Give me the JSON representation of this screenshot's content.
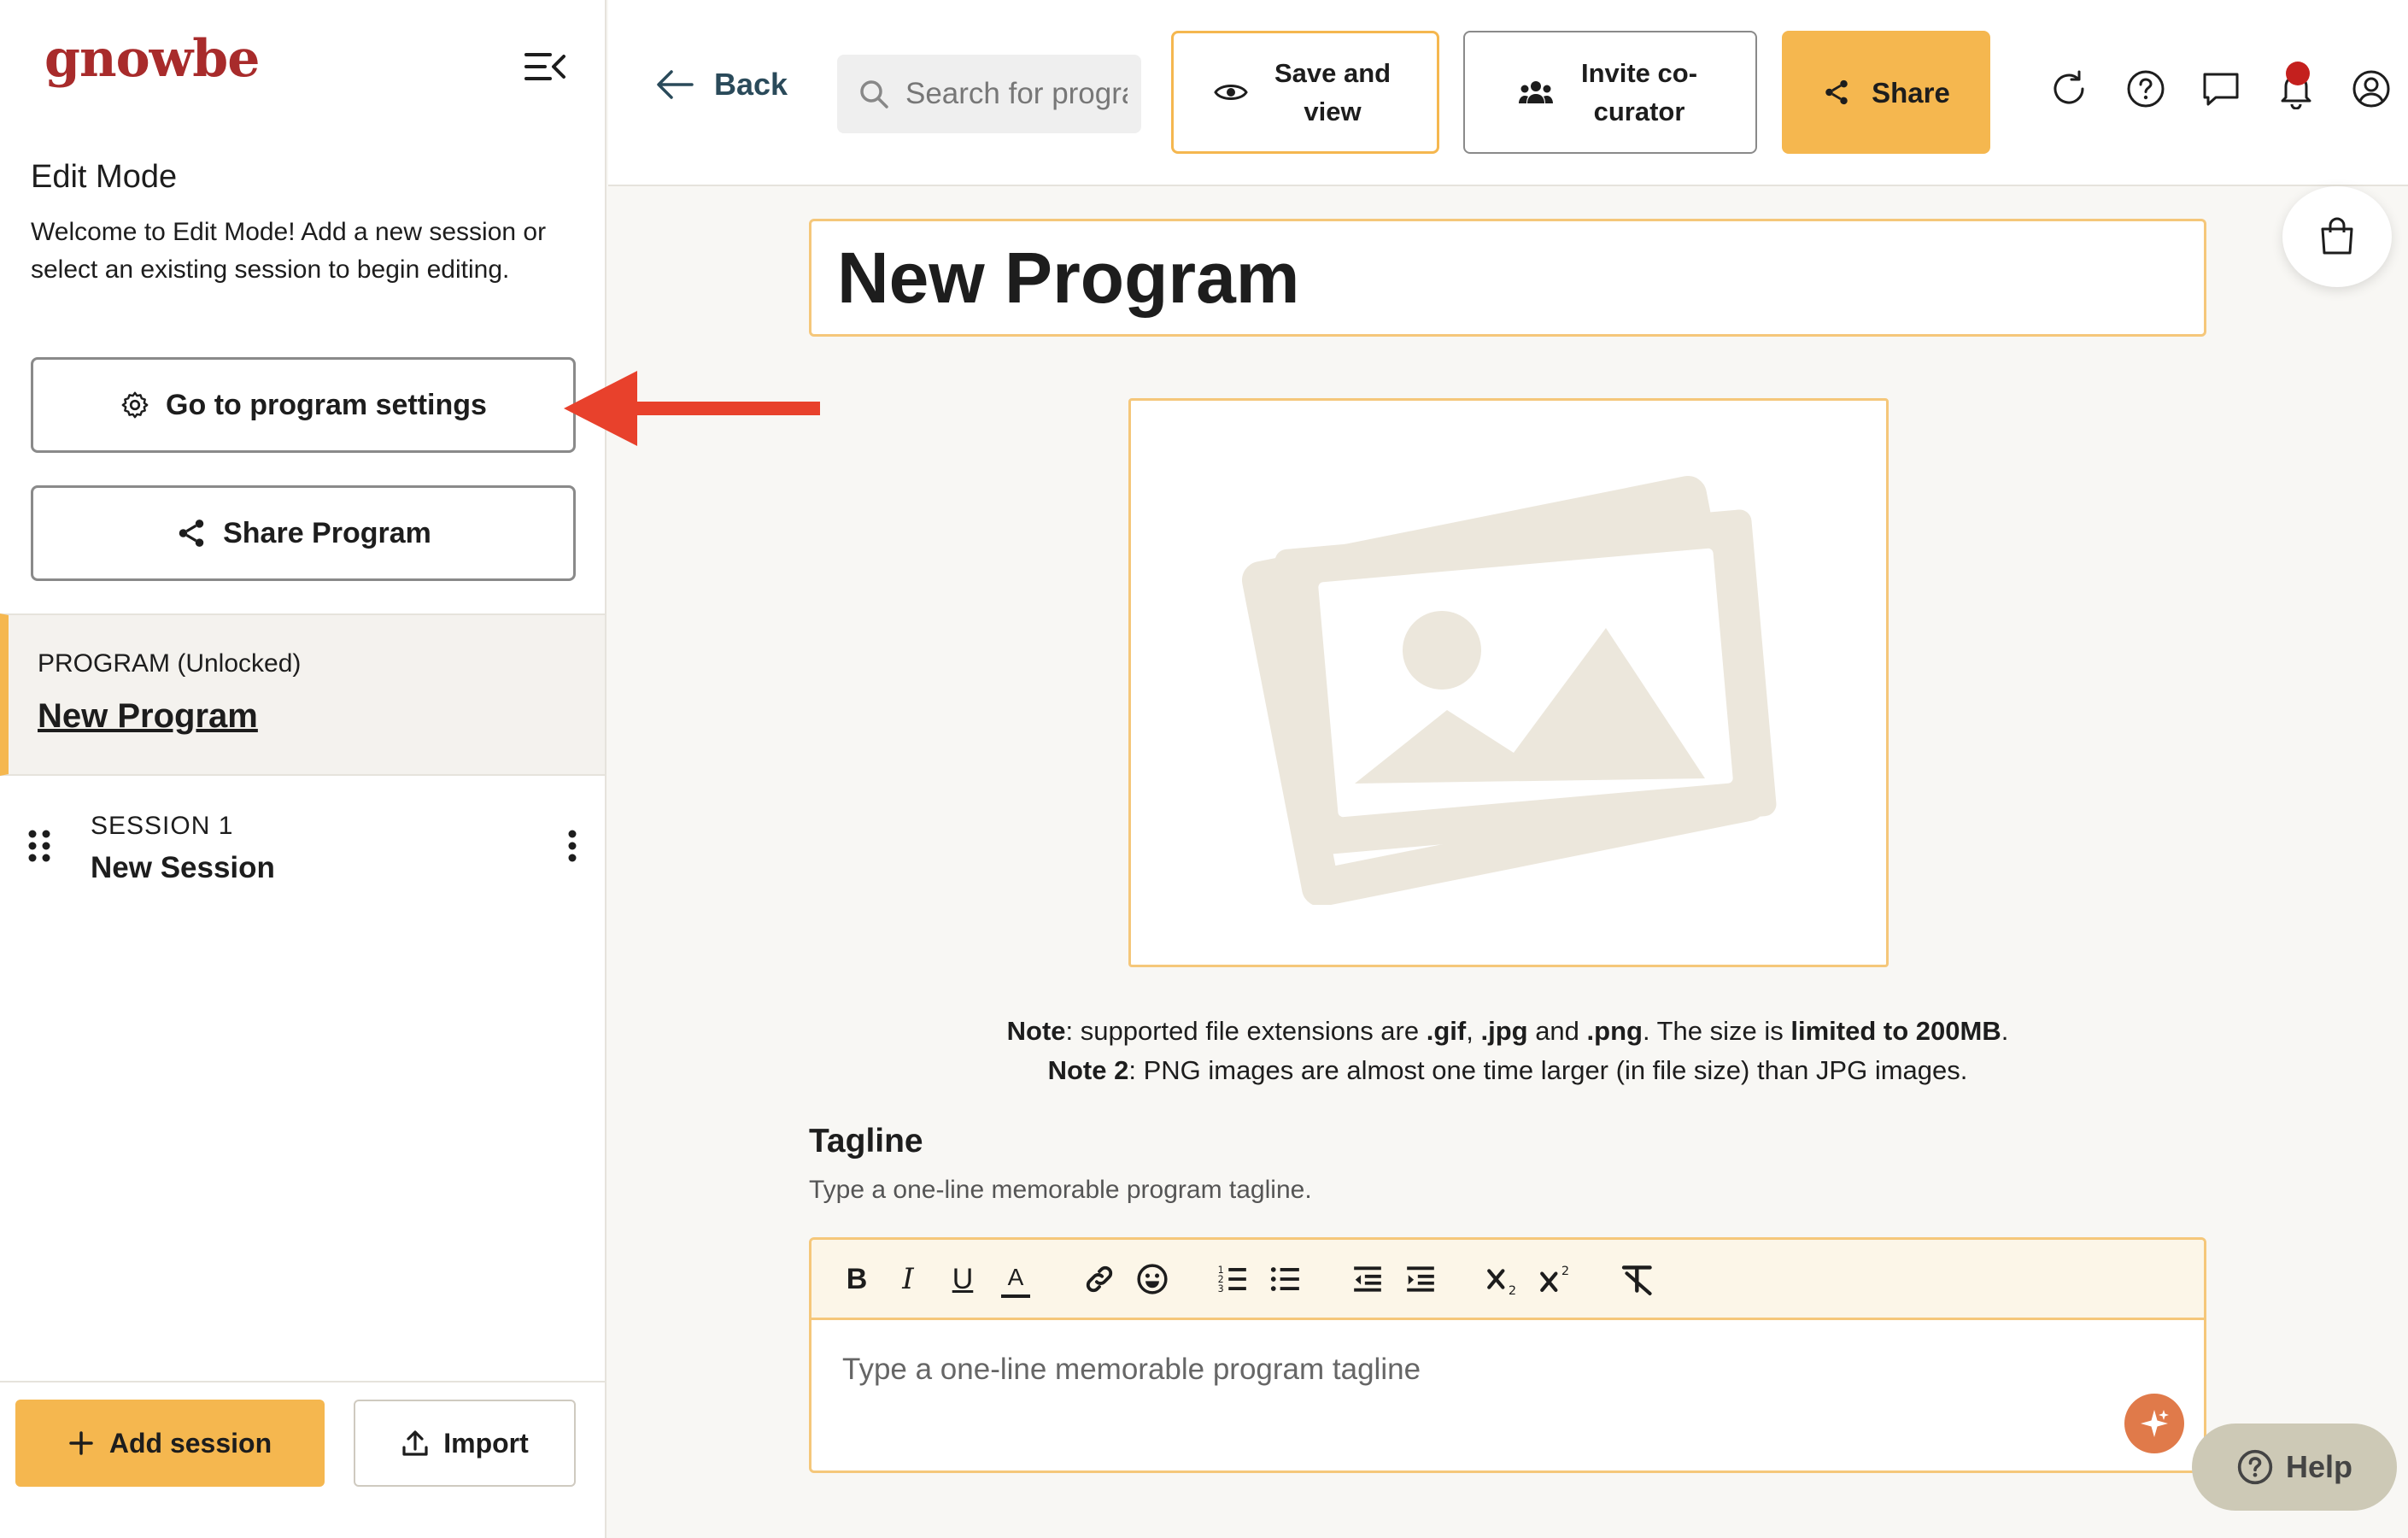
{
  "sidebar": {
    "logo": "gnowbe",
    "edit_title": "Edit Mode",
    "edit_desc": "Welcome to Edit Mode! Add a new session or select an existing session to begin editing.",
    "settings_label": "Go to program settings",
    "share_program_label": "Share Program",
    "program_label": "PROGRAM (Unlocked)",
    "program_name": "New Program",
    "session_label": "SESSION 1",
    "session_name": "New Session",
    "add_session_label": "Add session",
    "import_label": "Import"
  },
  "header": {
    "back_label": "Back",
    "search_placeholder": "Search for programs",
    "save_view_label": "Save and view",
    "invite_label": "Invite co-curator",
    "share_label": "Share"
  },
  "main": {
    "program_title": "New Program",
    "note1_label": "Note",
    "note1_text_a": ": supported file extensions are ",
    "note1_gif": ".gif",
    "note1_sep1": ", ",
    "note1_jpg": ".jpg",
    "note1_and": " and ",
    "note1_png": ".png",
    "note1_text_b": ". The size is ",
    "note1_limit": "limited to 200MB",
    "note1_end": ".",
    "note2_label": "Note 2",
    "note2_text": ": PNG images are almost one time larger (in file size) than JPG images.",
    "tagline_title": "Tagline",
    "tagline_desc": "Type a one-line memorable program tagline.",
    "tagline_placeholder": "Type a one-line memorable program tagline",
    "toolbar": {
      "bold": "B",
      "italic": "I",
      "underline": "U",
      "color": "A"
    },
    "help_label": "Help"
  },
  "colors": {
    "accent": "#f5b74f",
    "brand": "#a82b2b",
    "arrow": "#e8412c",
    "notification": "#c4201e"
  }
}
